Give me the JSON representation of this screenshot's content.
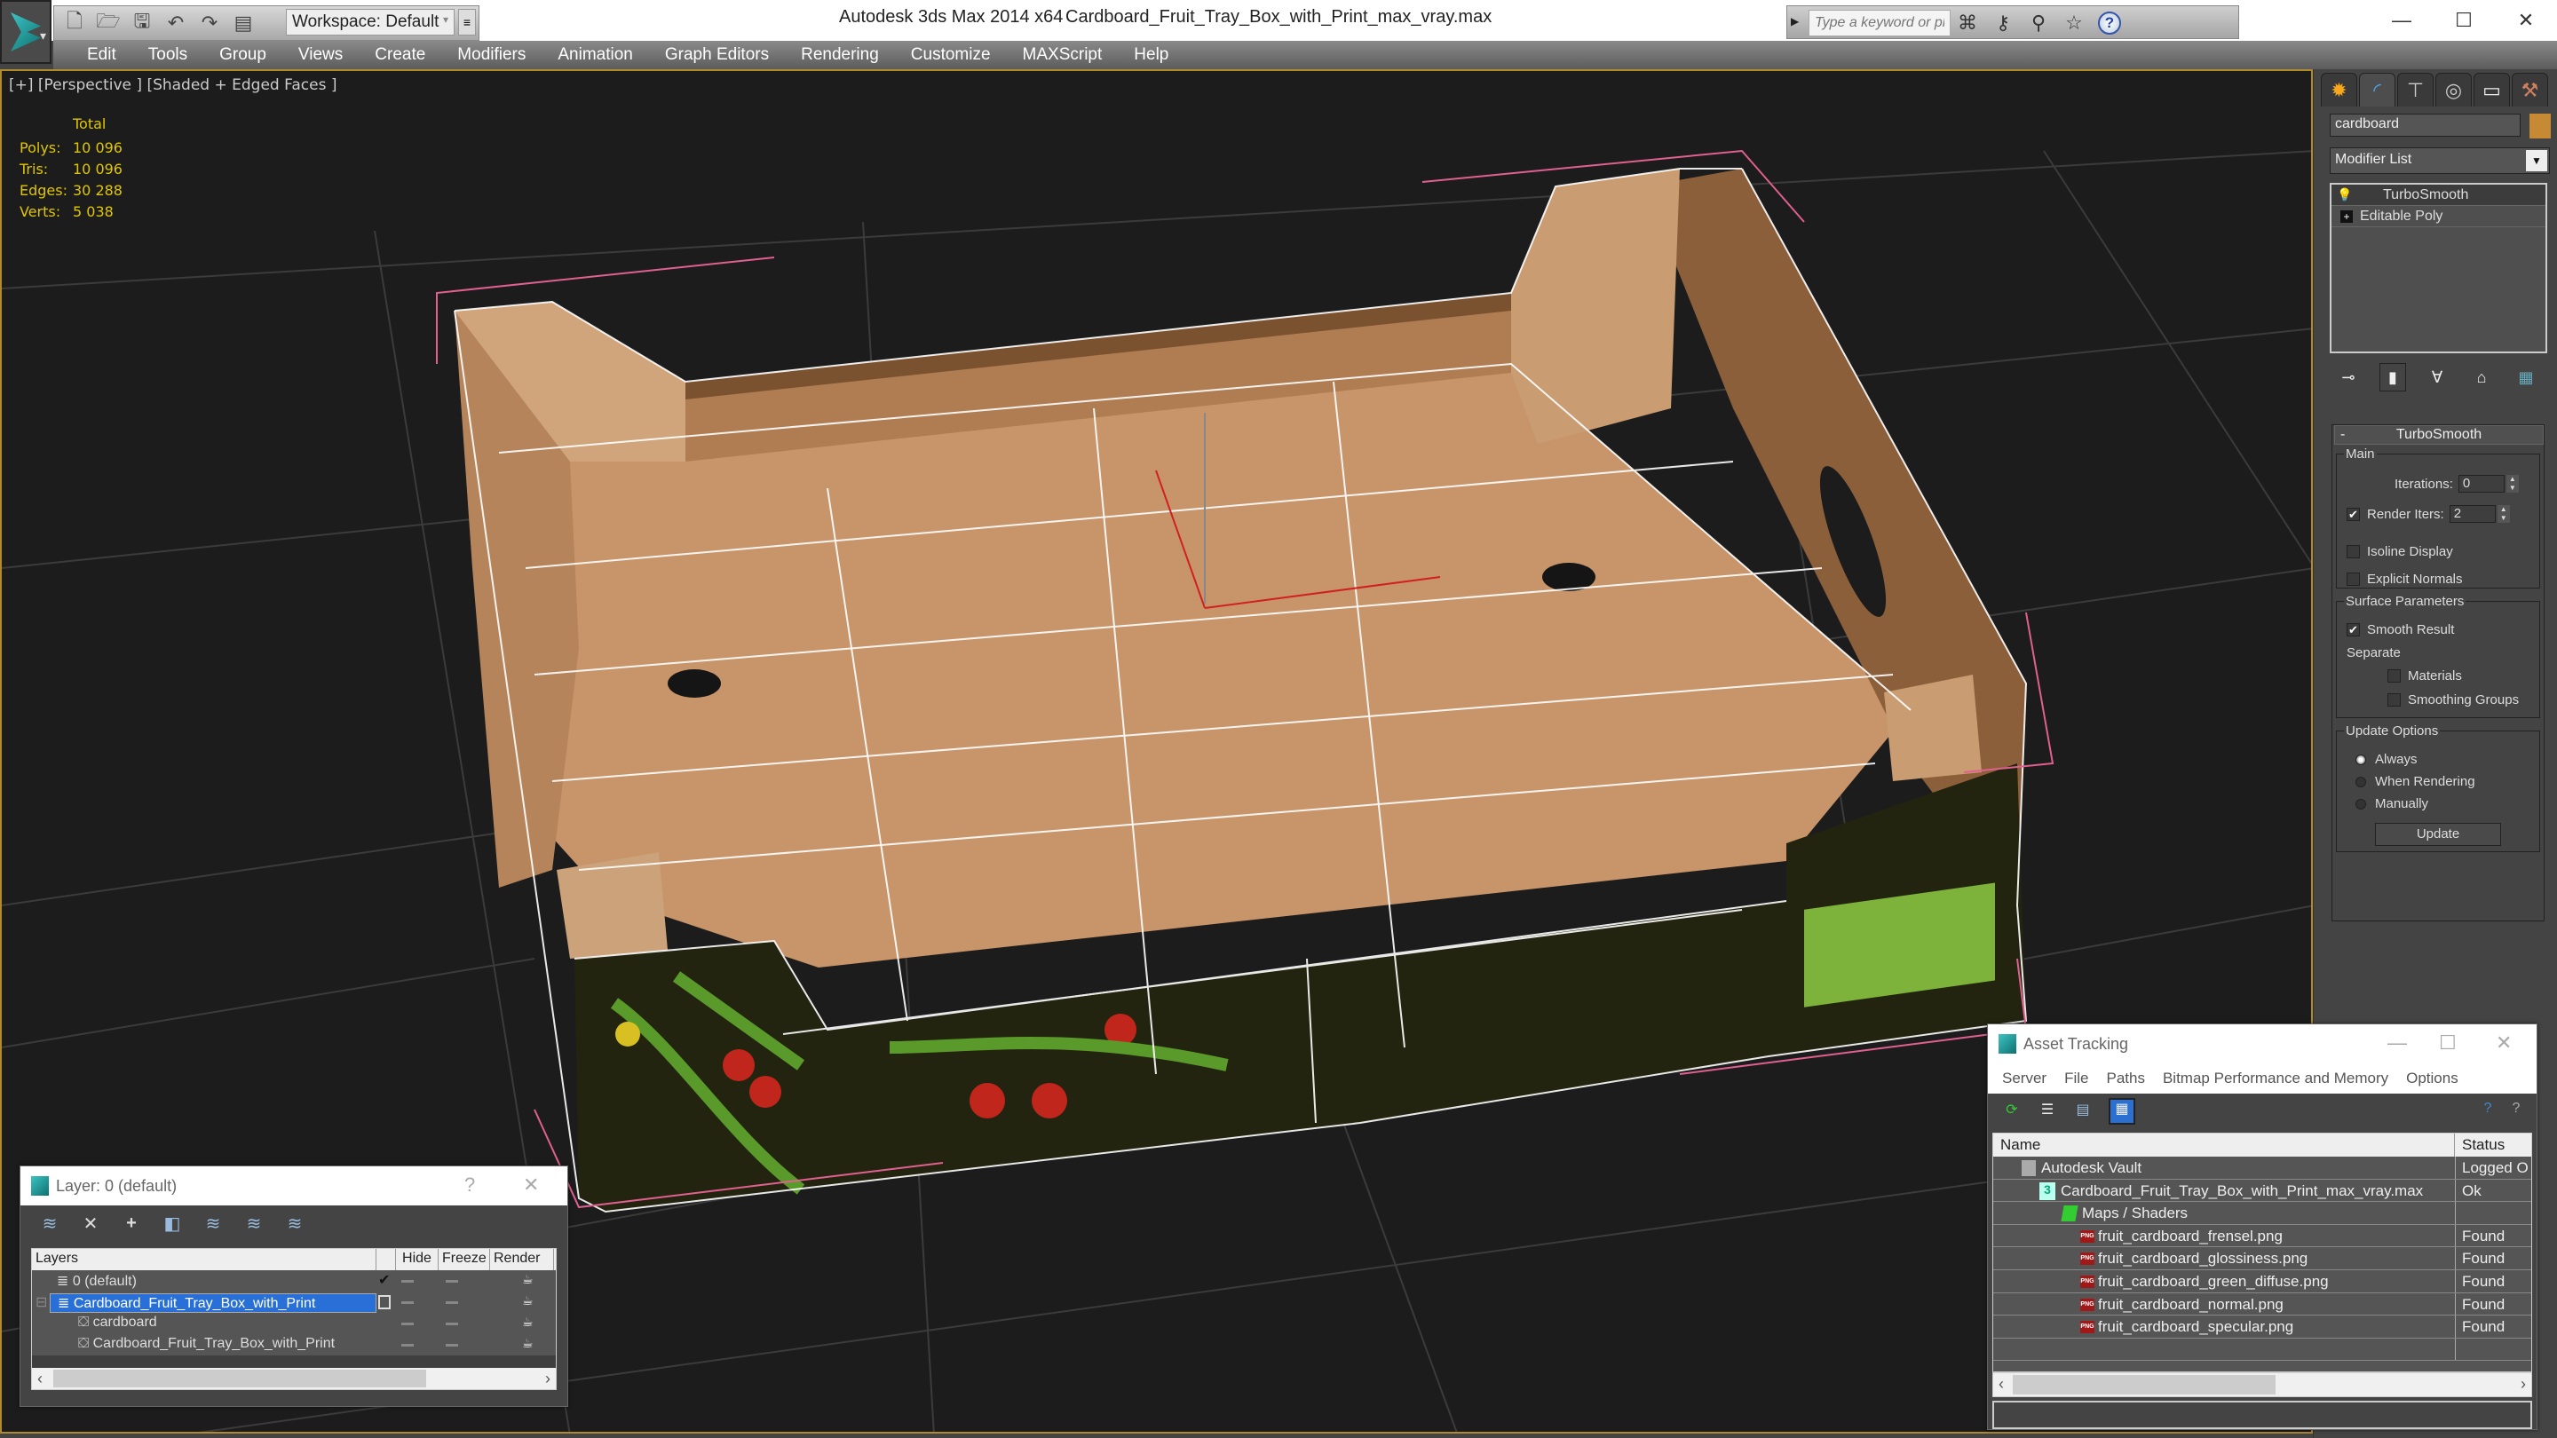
{
  "window": {
    "app_title": "Autodesk 3ds Max  2014 x64",
    "doc_title": "Cardboard_Fruit_Tray_Box_with_Print_max_vray.max",
    "workspace_label": "Workspace: Default",
    "search_placeholder": "Type a keyword or phrase",
    "controls": {
      "minimize": "—",
      "maximize": "☐",
      "close": "✕"
    }
  },
  "quick_access": {
    "icons": [
      "new-file-icon",
      "open-folder-icon",
      "save-icon",
      "undo-icon",
      "redo-icon",
      "project-folder-icon"
    ]
  },
  "menubar": {
    "items": [
      "Edit",
      "Tools",
      "Group",
      "Views",
      "Create",
      "Modifiers",
      "Animation",
      "Graph Editors",
      "Rendering",
      "Customize",
      "MAXScript",
      "Help"
    ]
  },
  "viewport": {
    "label": "[+] [Perspective ] [Shaded + Edged Faces ]",
    "stats": {
      "header": "Total",
      "rows": [
        {
          "label": "Polys:",
          "value": "10 096"
        },
        {
          "label": "Tris:",
          "value": "10 096"
        },
        {
          "label": "Edges:",
          "value": "30 288"
        },
        {
          "label": "Verts:",
          "value": "5 038"
        }
      ]
    },
    "colors": {
      "background": "#1c1c1c",
      "grid": "#3a3a3a",
      "cardboard": "#c8956a",
      "print_dark": "#23240f",
      "accent_green": "#7db33a",
      "tomato_red": "#c0261c",
      "selection_bracket": "#e06090",
      "border": "#b08a2c"
    }
  },
  "command_panel": {
    "tabs": [
      "create-tab",
      "modify-tab",
      "hierarchy-tab",
      "motion-tab",
      "display-tab",
      "utilities-tab"
    ],
    "active_tab": "modify-tab",
    "object_name": "cardboard",
    "object_color": "#c78a34",
    "modifier_list_label": "Modifier List",
    "stack": [
      {
        "label": "TurboSmooth",
        "selected": true
      },
      {
        "label": "Editable Poly",
        "selected": false
      }
    ],
    "rollout": {
      "title": "TurboSmooth",
      "main": {
        "legend": "Main",
        "iterations_label": "Iterations:",
        "iterations_value": "0",
        "render_iters_label": "Render Iters:",
        "render_iters_value": "2",
        "render_iters_checked": true,
        "isoline_label": "Isoline Display",
        "isoline_checked": false,
        "explicit_normals_label": "Explicit Normals",
        "explicit_normals_checked": false
      },
      "surface": {
        "legend": "Surface Parameters",
        "smooth_result_label": "Smooth Result",
        "smooth_result_checked": true,
        "separate_label": "Separate",
        "materials_label": "Materials",
        "smoothing_groups_label": "Smoothing Groups"
      },
      "update": {
        "legend": "Update Options",
        "options": [
          "Always",
          "When Rendering",
          "Manually"
        ],
        "selected": "Always",
        "button_label": "Update"
      }
    }
  },
  "layer_window": {
    "title": "Layer: 0 (default)",
    "help": "?",
    "close": "✕",
    "columns": [
      "Layers",
      "",
      "Hide",
      "Freeze",
      "Render"
    ],
    "rows": [
      {
        "name": "0 (default)",
        "indent": 1,
        "current": true,
        "selected": false
      },
      {
        "name": "Cardboard_Fruit_Tray_Box_with_Print",
        "indent": 1,
        "current": false,
        "selected": true,
        "expanded": true
      },
      {
        "name": "cardboard",
        "indent": 2,
        "current": false,
        "selected": false
      },
      {
        "name": "Cardboard_Fruit_Tray_Box_with_Print",
        "indent": 2,
        "current": false,
        "selected": false
      }
    ]
  },
  "asset_window": {
    "title": "Asset Tracking",
    "menu": [
      "Server",
      "File",
      "Paths",
      "Bitmap Performance and Memory",
      "Options"
    ],
    "columns": [
      "Name",
      "Status"
    ],
    "rows": [
      {
        "name": "Autodesk Vault",
        "status": "Logged O",
        "icon": "vault-icon",
        "level": 0
      },
      {
        "name": "Cardboard_Fruit_Tray_Box_with_Print_max_vray.max",
        "status": "Ok",
        "icon": "max-file-icon",
        "level": 1
      },
      {
        "name": "Maps / Shaders",
        "status": "",
        "icon": "maps-icon",
        "level": 2
      },
      {
        "name": "fruit_cardboard_frensel.png",
        "status": "Found",
        "icon": "png-icon",
        "level": 3
      },
      {
        "name": "fruit_cardboard_glossiness.png",
        "status": "Found",
        "icon": "png-icon",
        "level": 3
      },
      {
        "name": "fruit_cardboard_green_diffuse.png",
        "status": "Found",
        "icon": "png-icon",
        "level": 3
      },
      {
        "name": "fruit_cardboard_normal.png",
        "status": "Found",
        "icon": "png-icon",
        "level": 3
      },
      {
        "name": "fruit_cardboard_specular.png",
        "status": "Found",
        "icon": "png-icon",
        "level": 3
      }
    ]
  }
}
